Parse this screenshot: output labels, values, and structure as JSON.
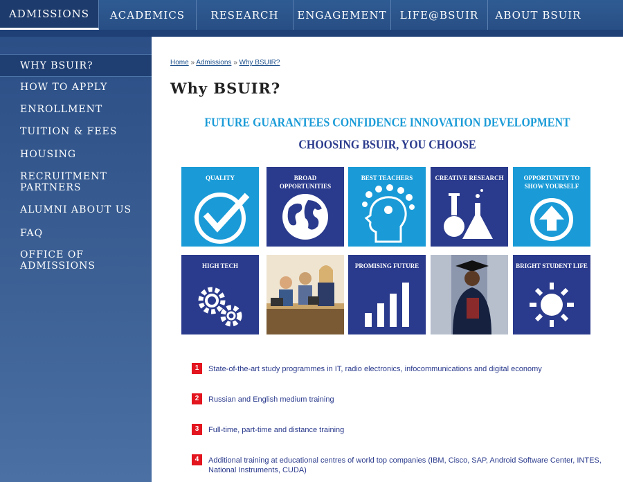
{
  "topnav": {
    "tabs": [
      {
        "label": "ADMISSIONS"
      },
      {
        "label": "ACADEMICS"
      },
      {
        "label": "RESEARCH"
      },
      {
        "label": "ENGAGEMENT"
      },
      {
        "label": "LIFE@BSUIR"
      },
      {
        "label": "ABOUT BSUIR"
      }
    ]
  },
  "sidebar": {
    "items": [
      {
        "label": "WHY BSUIR?"
      },
      {
        "label": "HOW TO APPLY"
      },
      {
        "label": "ENROLLMENT"
      },
      {
        "label": "TUITION & FEES"
      },
      {
        "label": "HOUSING"
      },
      {
        "label": "RECRUITMENT PARTNERS"
      },
      {
        "label": "ALUMNI ABOUT US"
      },
      {
        "label": "FAQ"
      },
      {
        "label": "OFFICE OF ADMISSIONS"
      }
    ]
  },
  "breadcrumb": {
    "home": "Home",
    "sep": "»",
    "admissions": "Admissions",
    "current": "Why BSUIR?"
  },
  "page": {
    "title": "Why BSUIR?",
    "slogan_line1": "FUTURE GUARANTEES CONFIDENCE INNOVATION DEVELOPMENT",
    "slogan_line2": "CHOOSING BSUIR, YOU CHOOSE"
  },
  "tiles": [
    {
      "label": "QUALITY",
      "icon": "checkmark-icon",
      "color": "#1a9bd7"
    },
    {
      "label": "BROAD OPPORTUNITIES",
      "icon": "globe-icon",
      "color": "#2a3a8c"
    },
    {
      "label": "BEST TEACHERS",
      "icon": "head-brain-icon",
      "color": "#1a9bd7"
    },
    {
      "label": "CREATIVE RESEARCH",
      "icon": "flasks-icon",
      "color": "#2a3a8c"
    },
    {
      "label": "OPPORTUNITY TO SHOW YOURSELF",
      "icon": "arrow-up-circle-icon",
      "color": "#1a9bd7"
    },
    {
      "label": "HIGH TECH",
      "icon": "gears-icon",
      "color": "#2a3a8c"
    },
    {
      "label": "",
      "icon": "students-photo",
      "color": "#d9c9a8"
    },
    {
      "label": "PROMISING FUTURE",
      "icon": "bar-growth-icon",
      "color": "#2a3a8c"
    },
    {
      "label": "",
      "icon": "graduate-photo",
      "color": "#6b7894"
    },
    {
      "label": "BRIGHT STUDENT LIFE",
      "icon": "sun-icon",
      "color": "#2a3a8c"
    }
  ],
  "features": [
    {
      "num": "1",
      "text": "State-of-the-art study programmes in IT, radio electronics, infocommunications and digital economy"
    },
    {
      "num": "2",
      "text": "Russian and English medium training"
    },
    {
      "num": "3",
      "text": "Full-time, part-time and distance training"
    },
    {
      "num": "4",
      "text": "Additional training at educational centres of world top companies (IBM, Cisco, SAP, Android Software Center, INTES, National Instruments, CUDA)"
    }
  ],
  "colors": {
    "nav_bg": "#2f5b93",
    "sidebar_bg": "#3e6296",
    "accent_blue": "#1a9bd7",
    "accent_navy": "#2a3a8c",
    "number_red": "#e3151e"
  }
}
